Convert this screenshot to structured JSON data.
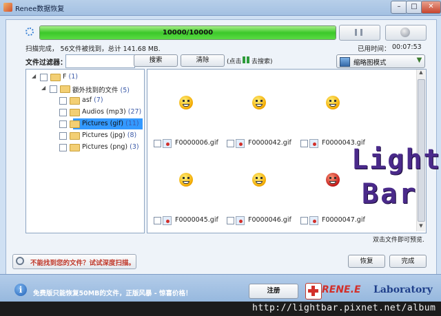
{
  "window": {
    "title": "Renee数据恢复",
    "buttons": {
      "minimize": "–",
      "maximize": "□",
      "close": "✕"
    }
  },
  "scan": {
    "progress_text": "10000/10000",
    "progress_percent": 100,
    "status": "扫描完成， 56文件被找到，总计 141.68 MB.",
    "elapsed_label": "已用时间：",
    "elapsed_value": "00:07:53"
  },
  "filter": {
    "label": "文件过滤器：",
    "value": "",
    "search_label": "搜索",
    "clear_label": "清除",
    "hint_pre": "(点击",
    "hint_post": "去搜索)"
  },
  "view_mode": {
    "label": "缩略图模式"
  },
  "tree": [
    {
      "level": 0,
      "expander": "◢",
      "name": "F",
      "count": "(1)",
      "selected": false
    },
    {
      "level": 1,
      "expander": "◢",
      "name": "额外找到的文件",
      "count": "(5)",
      "selected": false
    },
    {
      "level": 2,
      "expander": "",
      "name": "asf",
      "count": "(7)",
      "selected": false
    },
    {
      "level": 2,
      "expander": "",
      "name": "Audios (mp3)",
      "count": "(27)",
      "selected": false
    },
    {
      "level": 2,
      "expander": "",
      "name": "Pictures (gif)",
      "count": "(11)",
      "selected": true
    },
    {
      "level": 2,
      "expander": "",
      "name": "Pictures (jpg)",
      "count": "(8)",
      "selected": false
    },
    {
      "level": 2,
      "expander": "",
      "name": "Pictures (png)",
      "count": "(3)",
      "selected": false
    }
  ],
  "thumbnails": [
    {
      "name": "F0000006.gif",
      "color": "yellow"
    },
    {
      "name": "F0000042.gif",
      "color": "yellow"
    },
    {
      "name": "F0000043.gif",
      "color": "yellow"
    },
    {
      "name": "F0000045.gif",
      "color": "yellow"
    },
    {
      "name": "F0000046.gif",
      "color": "yellow"
    },
    {
      "name": "F0000047.gif",
      "color": "red"
    }
  ],
  "watermark": {
    "line1": "Light",
    "line2": "Bar"
  },
  "preview_hint": "双击文件即可预览.",
  "deep_scan_label": "不能找到您的文件？试试深度扫描。",
  "recover_label": "恢复",
  "finish_label": "完成",
  "footer": {
    "promo": "免费版只能恢复50MB的文件，正版风暴 - 惊喜价格！",
    "register_label": "注册",
    "brand_name": "RENE.E",
    "brand_lab": "Laboratory"
  },
  "url": "http://lightbar.pixnet.net/album"
}
